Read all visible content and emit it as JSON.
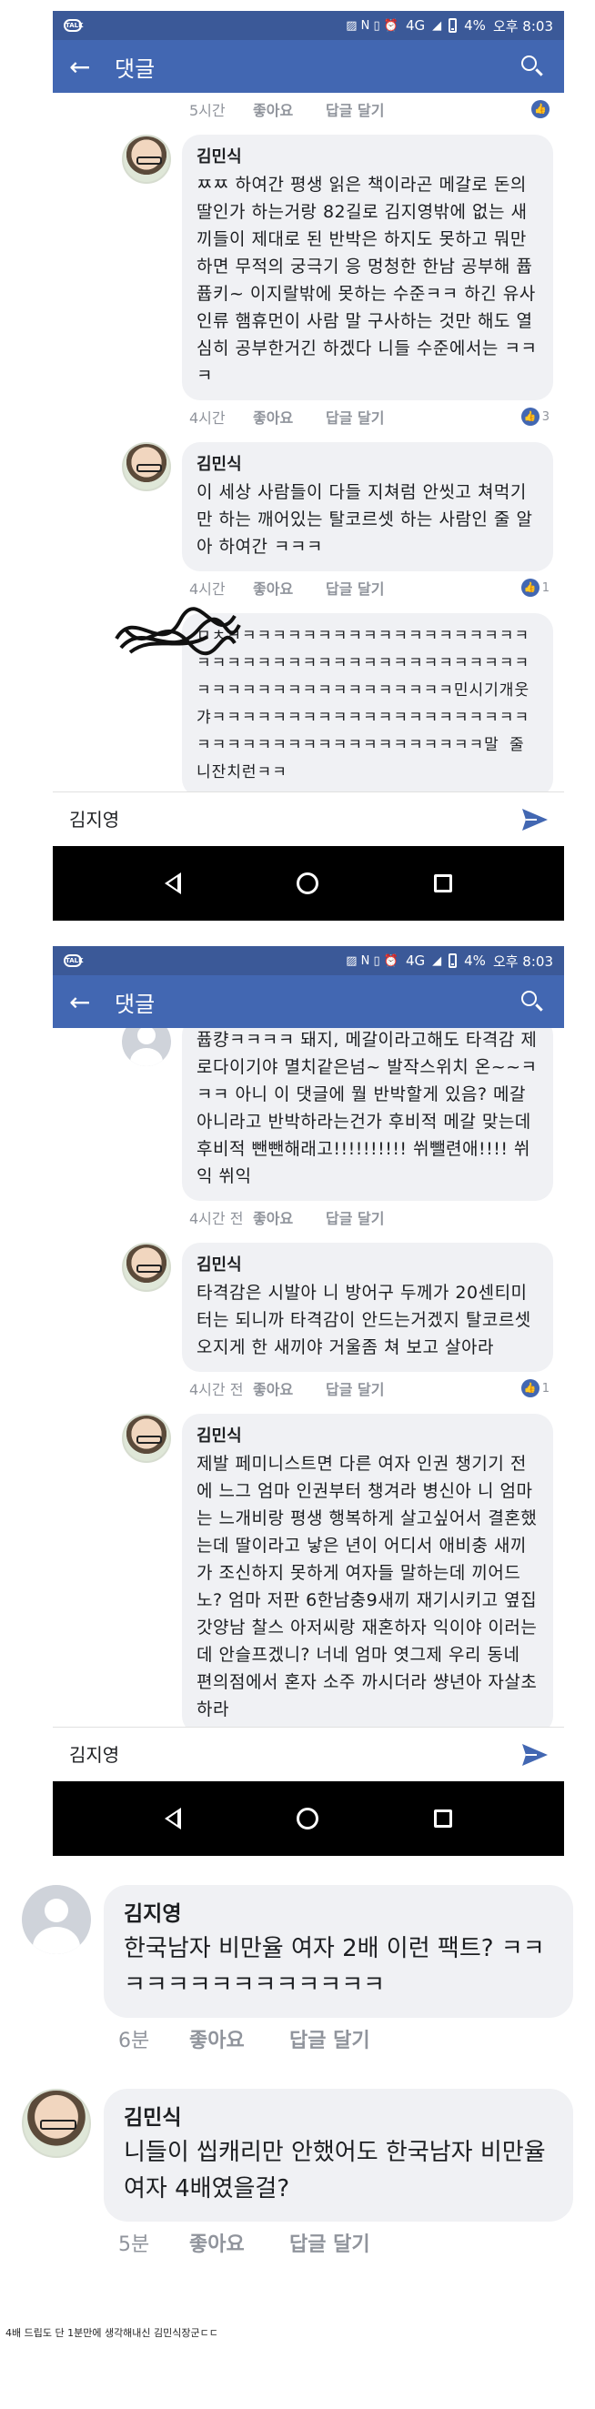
{
  "phone1": {
    "status": {
      "network": "4G",
      "battery": "4%",
      "clock": "오후 8:03"
    },
    "appbar": {
      "title": "댓글"
    },
    "top_actions": {
      "time": "5시간",
      "like": "좋아요",
      "reply": "답글 달기",
      "reactions": ""
    },
    "comments": [
      {
        "name": "김민식",
        "text": "ㅉㅉ 하여간 평생 읽은 책이라곤 메갈로 돈의 딸인가 하는거랑 82길로 김지영밖에 없는 새끼들이 제대로 된 반박은 하지도 못하고 뭐만 하면 무적의 궁극기 응 멍청한 한남 공부해 퓹퓹키~ 이지랄밖에 못하는 수준ㅋㅋ 하긴 유사인류 햄휴먼이 사람 말 구사하는 것만 해도 열심히 공부한거긴 하겠다 니들 수준에서는 ㅋㅋㅋ",
        "time": "4시간",
        "like": "좋아요",
        "reply": "답글 달기",
        "reactions": "3"
      },
      {
        "name": "김민식",
        "text": "이 세상 사람들이 다들 지쳐럼 안씻고 쳐먹기만 하는 깨어있는 탈코르셋 하는 사람인 줄 알아 하여간 ㅋㅋㅋ",
        "time": "4시간",
        "like": "좋아요",
        "reply": "답글 달기",
        "reactions": "1"
      },
      {
        "name": "",
        "text": "ㅁㅊㅋㅋㅋㅋㅋㅋㅋㅋㅋㅋㅋㅋㅋㅋㅋㅋㅋㅋㅋㅋㅋㅋㅋㅋㅋㅋㅋㅋㅋㅋㅋㅋㅋㅋㅋㅋㅋㅋㅋㅋㅋㅋㅋㅋㅋㅋㅋㅋㅋㅋㅋㅋㅋㅋㅋㅋㅋㅋㅋ민시기개웃갸ㅋㅋㅋㅋㅋㅋㅋㅋㅋㅋㅋㅋㅋㅋㅋㅋㅋㅋㅋㅋㅋㅋㅋㅋㅋㅋㅋㅋㅋㅋㅋㅋㅋㅋㅋㅋㅋㅋㅋㅋ말 줄니잔치런ㅋㅋ"
      }
    ],
    "composer": {
      "value": "김지영"
    }
  },
  "phone2": {
    "status": {
      "network": "4G",
      "battery": "4%",
      "clock": "오후 8:03"
    },
    "appbar": {
      "title": "댓글"
    },
    "comments": [
      {
        "name": "",
        "text": "퓹컁ㅋㅋㅋㅋ 돼지, 메갈이라고해도 타격감 제로다이기야 멸치같은넘~ 발작스위치 온~~ㅋㅋㅋ 아니 이 댓글에 뭘 반박할게 있음? 메갈 아니라고 반박하라는건가 후비적 메갈 맞는데 후비적 뺀뺀해래고!!!!!!!!!! 쒸뺄련애!!!! 쒸익 쒸익",
        "time": "4시간 전",
        "like": "좋아요",
        "reply": "답글 달기"
      },
      {
        "name": "김민식",
        "text": "타격감은 시발아 니 방어구 두께가 20센티미터는 되니까 타격감이 안드는거겠지 탈코르셋 오지게 한 새끼야 거울좀 쳐 보고 살아라",
        "time": "4시간 전",
        "like": "좋아요",
        "reply": "답글 달기",
        "reactions": "1"
      },
      {
        "name": "김민식",
        "text": "제발 페미니스트면 다른 여자 인권 챙기기 전에 느그 엄마 인권부터 챙겨라 병신아 니 엄마는 느개비랑 평생 행복하게 살고싶어서 결혼했는데 딸이라고 낳은 년이 어디서 애비충 새끼가 조신하지 못하게 여자들 말하는데 끼어드노? 엄마 저판 6한남충9새끼 재기시키고 옆집 갓양남 찰스 아저씨랑 재혼하자 익이야 이러는데 안슬프겠니? 너네 엄마 엿그제 우리 동네 편의점에서 혼자 소주 까시더라 썅년아 자살초 하라"
      }
    ],
    "composer": {
      "value": "김지영"
    }
  },
  "big_comments": [
    {
      "name": "김지영",
      "text": "한국남자 비만율 여자 2배 이런 팩트? ㅋㅋㅋㅋㅋㅋㅋㅋㅋㅋㅋㅋㅋㅋ",
      "time": "6분",
      "like": "좋아요",
      "reply": "답글 달기"
    },
    {
      "name": "김민식",
      "text": "니들이 씹캐리만 안했어도 한국남자 비만율 여자 4배였을걸?",
      "time": "5분",
      "like": "좋아요",
      "reply": "답글 달기"
    }
  ],
  "footnote": "4배 드립도 단 1분만에 생각해내신 김민식장군ㄷㄷ",
  "colors": {
    "status_bar": "#3b5998",
    "app_bar": "#4267b2",
    "bubble": "#f0f1f4",
    "send": "#4267b2"
  },
  "icons": [
    "back-arrow-icon",
    "search-icon",
    "send-icon",
    "thumbs-up-icon",
    "nav-back-icon",
    "nav-home-icon",
    "nav-recent-icon"
  ]
}
